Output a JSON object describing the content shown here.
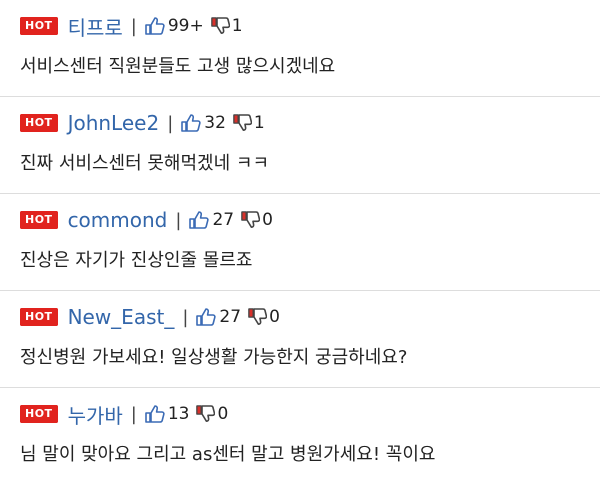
{
  "comments": [
    {
      "badge": "HOT",
      "author": "티프로",
      "separator": "|",
      "likes": "99+",
      "dislikes": "1",
      "text": "서비스센터 직원분들도 고생 많으시겠네요"
    },
    {
      "badge": "HOT",
      "author": "JohnLee2",
      "separator": "|",
      "likes": "32",
      "dislikes": "1",
      "text": "진짜 서비스센터 못해먹겠네 ㅋㅋ"
    },
    {
      "badge": "HOT",
      "author": "commond",
      "separator": "|",
      "likes": "27",
      "dislikes": "0",
      "text": "진상은 자기가 진상인줄 몰르죠"
    },
    {
      "badge": "HOT",
      "author": "New_East_",
      "separator": "|",
      "likes": "27",
      "dislikes": "0",
      "text": "정신병원 가보세요! 일상생활 가능한지 궁금하네요?"
    },
    {
      "badge": "HOT",
      "author": "누가바",
      "separator": "|",
      "likes": "13",
      "dislikes": "0",
      "text": "님 말이 맞아요 그리고 as센터 말고 병원가세요! 꼭이요"
    }
  ],
  "icons": {
    "like": "thumbs-up-icon",
    "dislike": "thumbs-down-icon"
  },
  "colors": {
    "badge": "#e1231e",
    "author": "#3366aa",
    "divider": "#dddddd"
  }
}
